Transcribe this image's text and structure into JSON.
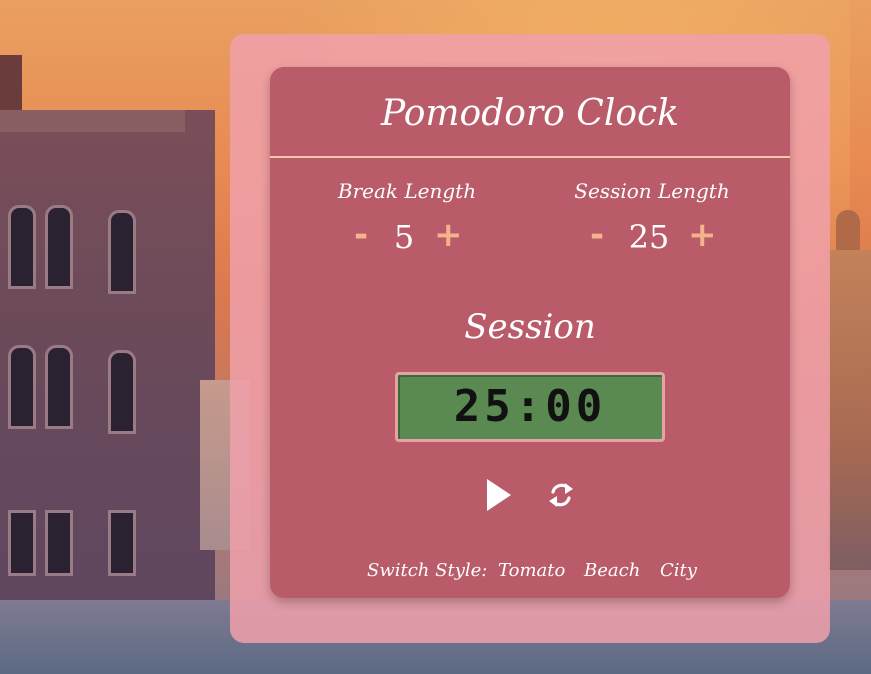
{
  "app": {
    "title": "Pomodoro Clock"
  },
  "break": {
    "label": "Break Length",
    "decrement": "-",
    "value": "5",
    "increment": "+"
  },
  "session": {
    "label": "Session Length",
    "decrement": "-",
    "value": "25",
    "increment": "+"
  },
  "timer": {
    "mode": "Session",
    "display": "25:00"
  },
  "controls": {
    "play": "play-icon",
    "reset": "refresh-icon"
  },
  "footer": {
    "label": "Switch Style:",
    "options": [
      "Tomato",
      "Beach",
      "City"
    ]
  },
  "colors": {
    "card": "#b95b68",
    "outer": "#f0a0aa",
    "accent": "#f3b38f",
    "display": "#5a8a52"
  }
}
